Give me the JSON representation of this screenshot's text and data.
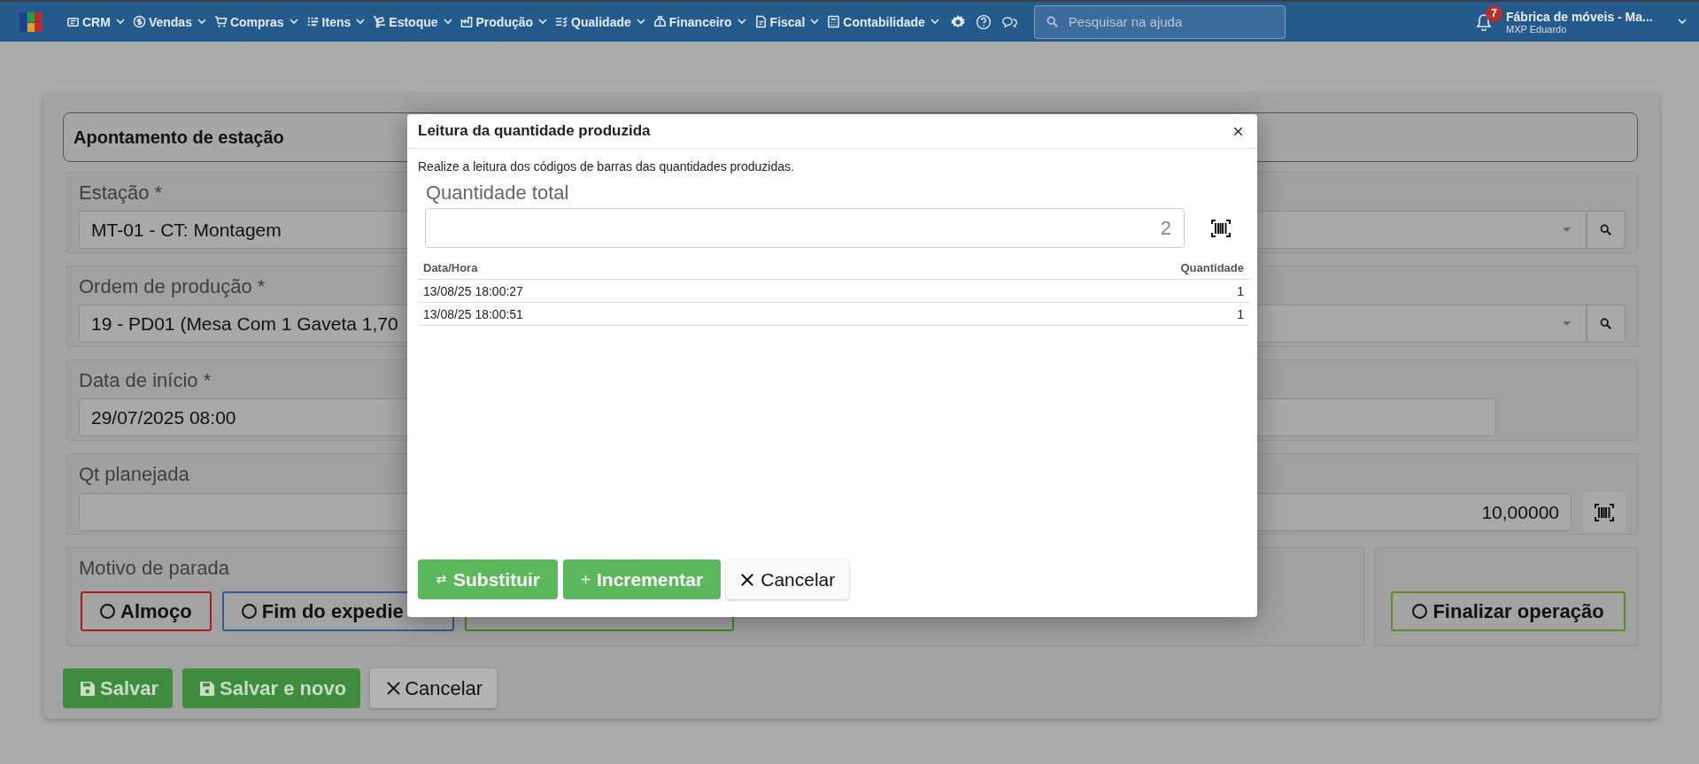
{
  "navbar": {
    "menus": [
      {
        "label": "CRM"
      },
      {
        "label": "Vendas"
      },
      {
        "label": "Compras"
      },
      {
        "label": "Itens"
      },
      {
        "label": "Estoque"
      },
      {
        "label": "Produção"
      },
      {
        "label": "Qualidade"
      },
      {
        "label": "Financeiro"
      },
      {
        "label": "Fiscal"
      },
      {
        "label": "Contabilidade"
      }
    ],
    "search": {
      "placeholder": "Pesquisar na ajuda"
    },
    "notifications": "7",
    "company": "Fábrica de móveis - Ma...",
    "user": "MXP Eduardo"
  },
  "form": {
    "title": "Apontamento de estação",
    "fields": [
      {
        "kind": "select",
        "label": "Estação *",
        "value": "MT-01 - CT: Montagem"
      },
      {
        "kind": "select",
        "label": "Ordem de produção *",
        "value": "19 - PD01 (Mesa Com 1 Gaveta 1,70"
      },
      {
        "kind": "date",
        "label": "Data de início *",
        "value": "29/07/2025 08:00"
      },
      {
        "kind": "number",
        "label": "Qt planejada",
        "value": "10,00000"
      }
    ],
    "stop_reasons": {
      "label": "Motivo de parada",
      "options": [
        {
          "label": "Almoço",
          "color": "#b01c1c"
        },
        {
          "label": "Fim do expedie",
          "color": "#2a5d99"
        },
        {
          "color": "#3e8e1e"
        }
      ]
    },
    "finish": {
      "label": "Finalizar operação",
      "color": "#5a8f28"
    },
    "actions": [
      {
        "label": "Salvar",
        "kind": "save"
      },
      {
        "label": "Salvar e novo",
        "kind": "save"
      },
      {
        "label": "Cancelar",
        "kind": "cancel"
      }
    ]
  },
  "modal": {
    "title": "Leitura da quantidade produzida",
    "description": "Realize a leitura dos códigos de barras das quantidades produzidas.",
    "total": {
      "label": "Quantidade total",
      "value": "2"
    },
    "columns": [
      "Data/Hora",
      "Quantidade"
    ],
    "rows": [
      [
        "13/08/25 18:00:27",
        "1"
      ],
      [
        "13/08/25 18:00:51",
        "1"
      ]
    ],
    "buttons": [
      {
        "label": "Substituir",
        "kind": "swap"
      },
      {
        "label": "Incrementar",
        "kind": "plus"
      },
      {
        "label": "Cancelar",
        "kind": "cancel"
      }
    ]
  }
}
